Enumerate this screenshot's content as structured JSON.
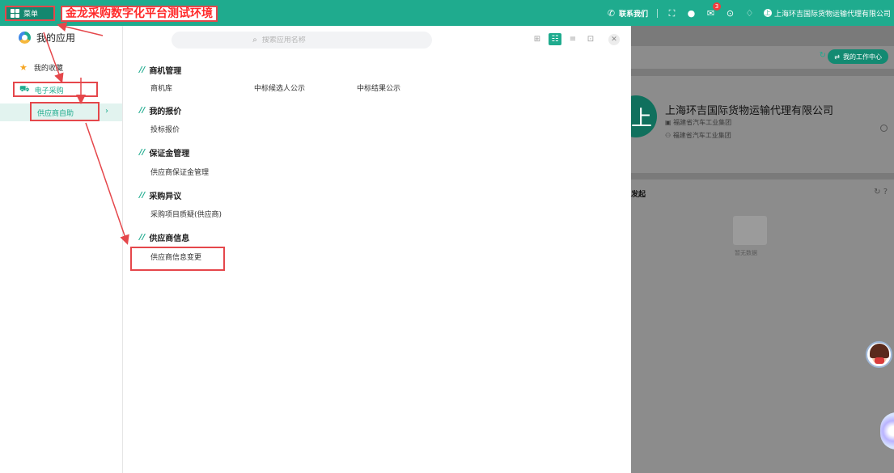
{
  "topbar": {
    "menu_label": "菜单",
    "app_title": "金龙采购数字化平台测试环境",
    "contact_label": "联系我们",
    "mail_badge": "3",
    "company": "上海环吉国际货物运输代理有限公司",
    "user_initial": "上"
  },
  "panel": {
    "title": "我的应用",
    "search_placeholder": "搜索应用名称",
    "sidebar": {
      "favorites": "我的收藏",
      "ecommerce": "电子采购",
      "supplier_self": "供应商自助"
    },
    "groups": [
      {
        "title": "商机管理",
        "apps": [
          "商机库",
          "中标候选人公示",
          "中标结果公示"
        ]
      },
      {
        "title": "我的报价",
        "apps": [
          "投标报价"
        ]
      },
      {
        "title": "保证金管理",
        "apps": [
          "供应商保证金管理"
        ]
      },
      {
        "title": "采购异议",
        "apps": [
          "采购项目质疑(供应商)"
        ]
      },
      {
        "title": "供应商信息",
        "apps": [
          "供应商信息变更"
        ]
      }
    ]
  },
  "dashboard": {
    "work_center": "我的工作中心",
    "company_name": "上海环吉国际货物运输代理有限公司",
    "group_1": "福建省汽车工业集团",
    "group_2": "福建省汽车工业集团",
    "avatar_initial": "上",
    "launch_title": "发起",
    "empty_text": "暂无数据"
  },
  "colors": {
    "brand": "#1fab8e",
    "annotation": "#e5474b"
  }
}
